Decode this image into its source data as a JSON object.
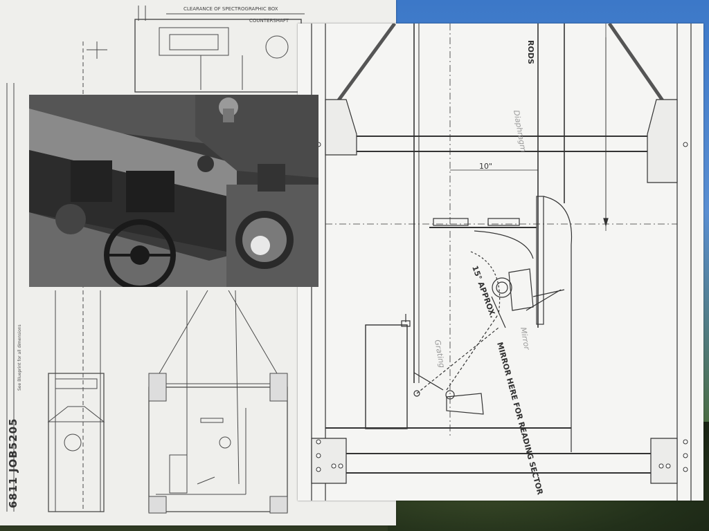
{
  "back_sheet": {
    "top_title": "CLEARANCE OF SPECTROGRAPHIC BOX",
    "counterweight": "COUNTERSHAFT",
    "side_note": "See Blueprint for all dimensions",
    "title_block_id": "6811 JOB5205"
  },
  "front_sheet": {
    "rods_label": "RODS",
    "dim_10": "10\"",
    "angle_label": "15° APPROX.",
    "mirror_label": "MIRROR HERE FOR READING SECTOR",
    "mirror_handwritten": "Mirror",
    "grating_handwritten": "Grating",
    "diaphragm_handwritten": "Diaphragm"
  },
  "colors": {
    "paper": "#f5f5f3",
    "line": "#3a3a3a",
    "sky": "#4a86cf"
  }
}
